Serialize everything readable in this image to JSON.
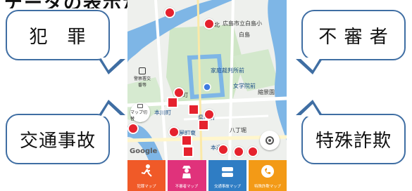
{
  "header": {
    "cut_title": "データの表示が可能"
  },
  "callouts": {
    "crime": "犯　罪",
    "suspicious": "不 審 者",
    "traffic": "交通事故",
    "fraud": "特殊詐欺"
  },
  "map": {
    "labels": {
      "hakushima": "白島",
      "castle": "城北",
      "school": "広島市立白島小",
      "museum": "家庭裁判所前",
      "womens": "女学院前",
      "shukkeien": "縮景園",
      "hatchobori": "八丁堀",
      "kenchomae": "県庁前",
      "honkawa": "本川町",
      "kamiyacho": "紙屋町東",
      "hondori": "本通",
      "moto": "基町",
      "police": "警察署交番等",
      "map_switch": "マップ切替",
      "google": "Google"
    }
  },
  "tabs": [
    {
      "label": "犯罪マップ",
      "color": "#f05a28",
      "icon": "runner-icon"
    },
    {
      "label": "不審者マップ",
      "color": "#e0327b",
      "icon": "suspicious-person-icon"
    },
    {
      "label": "交通事故マップ",
      "color": "#2f7dc4",
      "icon": "car-crash-icon"
    },
    {
      "label": "特殊詐欺マップ",
      "color": "#f39a16",
      "icon": "phone-fraud-icon"
    }
  ],
  "colors": {
    "bubble_border": "#3f6ea3",
    "pin": "#e5222e",
    "water": "#7eb6e6"
  }
}
